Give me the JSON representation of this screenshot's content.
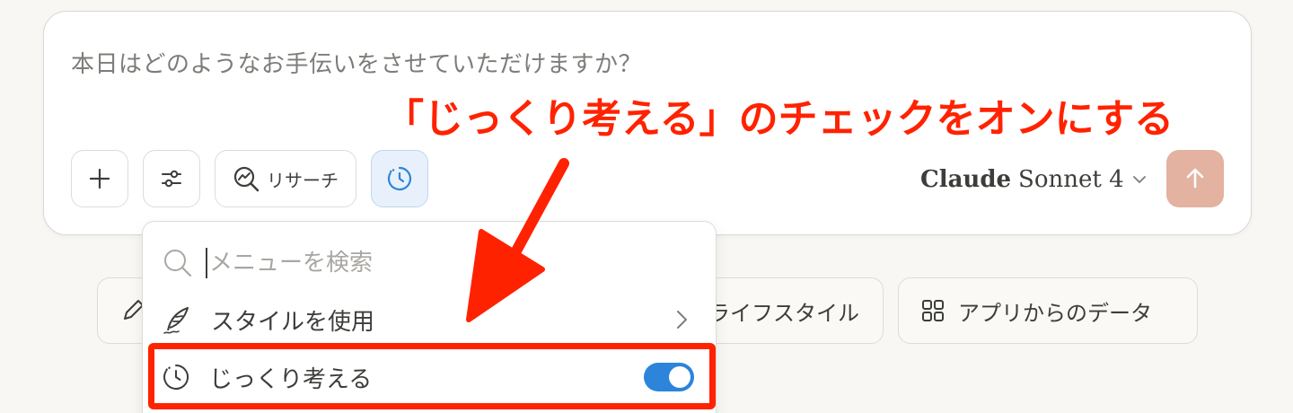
{
  "composer": {
    "placeholder": "本日はどのようなお手伝いをさせていただけますか？",
    "research_label": "リサーチ",
    "model_brand": "Claude",
    "model_name": "Sonnet 4"
  },
  "chips": {
    "lifestyle_label": "ライフスタイル",
    "apps_label": "アプリからのデータ"
  },
  "menu": {
    "search_placeholder": "メニューを検索",
    "items": [
      {
        "label": "スタイルを使用",
        "icon": "feather-icon",
        "has_submenu": true
      },
      {
        "label": "じっくり考える",
        "icon": "clock-icon",
        "toggle_on": true
      }
    ]
  },
  "annotation": {
    "text": "「じっくり考える」のチェックをオンにする"
  },
  "colors": {
    "accent_blue": "#2c84db",
    "send_button": "#e3b2a1",
    "annotation_red": "#ff2200"
  }
}
